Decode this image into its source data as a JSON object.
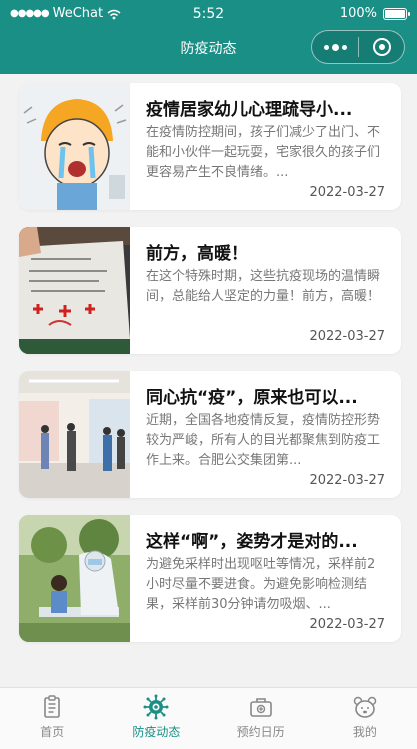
{
  "status_bar": {
    "carrier": "WeChat",
    "time": "5:52",
    "battery": "100%"
  },
  "nav": {
    "title": "防疫动态"
  },
  "colors": {
    "brand": "#1a8f86",
    "background": "#f2f2f2"
  },
  "articles": [
    {
      "title": "疫情居家幼儿心理疏导小...",
      "summary": "在疫情防控期间，孩子们减少了出门、不能和小伙伴一起玩耍，宅家很久的孩子们更容易产生不良情绪。...",
      "date": "2022-03-27"
    },
    {
      "title": "前方，高暖！",
      "summary": "在这个特殊时期，这些抗疫现场的温情瞬间，总能给人坚定的力量！前方，高暖！",
      "date": "2022-03-27"
    },
    {
      "title": "同心抗“疫”，原来也可以...",
      "summary": "近期，全国各地疫情反复，疫情防控形势较为严峻，所有人的目光都聚焦到防疫工作上来。合肥公交集团第...",
      "date": "2022-03-27"
    },
    {
      "title": "这样“啊”，姿势才是对的...",
      "summary": "为避免采样时出现呕吐等情况，采样前2小时尽量不要进食。为避免影响检测结果，采样前30分钟请勿吸烟、...",
      "date": "2022-03-27"
    }
  ],
  "tabs": [
    {
      "label": "首页",
      "icon": "clipboard-icon",
      "active": false
    },
    {
      "label": "防疫动态",
      "icon": "virus-icon",
      "active": true
    },
    {
      "label": "预约日历",
      "icon": "medical-kit-icon",
      "active": false
    },
    {
      "label": "我的",
      "icon": "bear-face-icon",
      "active": false
    }
  ]
}
